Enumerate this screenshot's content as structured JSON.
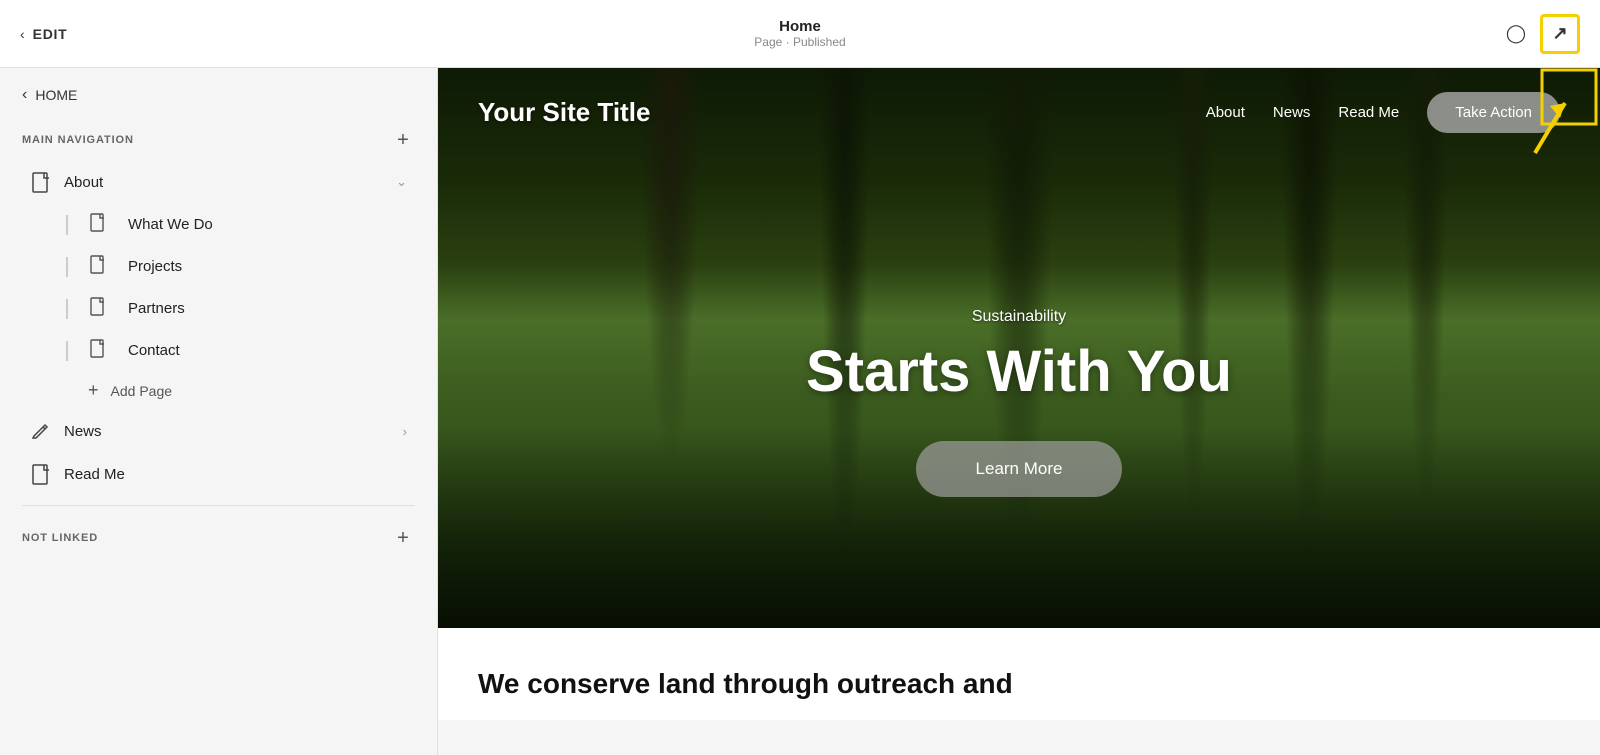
{
  "toolbar": {
    "back_label": "HOME",
    "edit_label": "EDIT",
    "page_name": "Home",
    "page_status": "Page · Published",
    "mobile_icon": "📱",
    "external_icon": "↗"
  },
  "sidebar": {
    "back_label": "HOME",
    "main_nav_label": "MAIN NAVIGATION",
    "add_button_label": "+",
    "items": [
      {
        "id": "about",
        "label": "About",
        "icon": "page",
        "has_chevron": true,
        "expanded": true
      },
      {
        "id": "news",
        "label": "News",
        "icon": "pencil",
        "has_chevron": true
      },
      {
        "id": "read-me",
        "label": "Read Me",
        "icon": "page",
        "has_chevron": false
      }
    ],
    "about_subitems": [
      {
        "id": "what-we-do",
        "label": "What We Do"
      },
      {
        "id": "projects",
        "label": "Projects"
      },
      {
        "id": "partners",
        "label": "Partners"
      },
      {
        "id": "contact",
        "label": "Contact"
      }
    ],
    "add_page_label": "Add Page",
    "not_linked_label": "NOT LINKED",
    "not_linked_add": "+"
  },
  "preview": {
    "site_title": "Your Site Title",
    "nav_links": [
      "About",
      "News",
      "Read Me"
    ],
    "cta_button": "Take Action",
    "hero_subtitle": "Sustainability",
    "hero_title": "Starts With You",
    "learn_more_button": "Learn More",
    "below_hero_text": "We conserve land through outreach and"
  }
}
